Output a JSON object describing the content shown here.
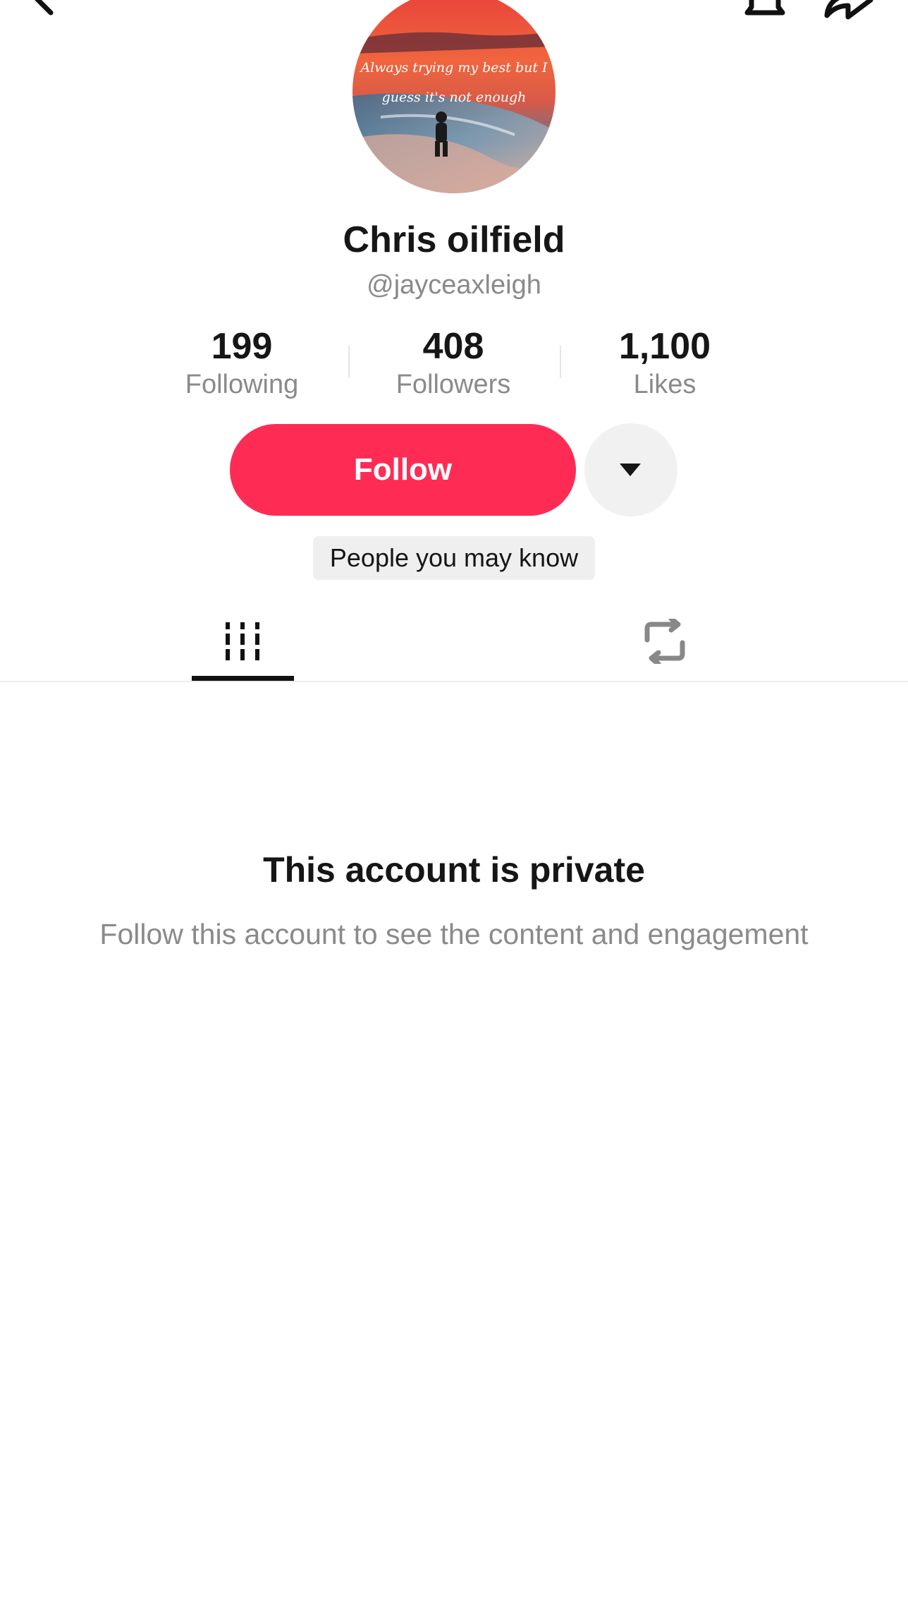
{
  "topbar": {
    "back_icon": "chevron-left-icon",
    "bell_icon": "bell-icon",
    "share_icon": "share-arrow-icon"
  },
  "profile": {
    "avatar_caption_line1": "Always trying my best but I",
    "avatar_caption_line2": "guess it's not enough",
    "display_name": "Chris oilfield",
    "handle": "@jayceaxleigh"
  },
  "stats": [
    {
      "value": "199",
      "label": "Following"
    },
    {
      "value": "408",
      "label": "Followers"
    },
    {
      "value": "1,100",
      "label": "Likes"
    }
  ],
  "actions": {
    "follow_label": "Follow",
    "more_icon": "caret-down-icon",
    "people_you_may_know_label": "People you may know"
  },
  "tabs": [
    {
      "name": "videos",
      "icon": "grid-columns-icon",
      "selected": true
    },
    {
      "name": "reposts",
      "icon": "repost-icon",
      "selected": false
    }
  ],
  "private_notice": {
    "title": "This account is private",
    "subtitle": "Follow this account to see the content and engagement"
  },
  "colors": {
    "accent": "#fe2c55",
    "muted_text": "#8a8a8a",
    "primary_text": "#161616"
  }
}
